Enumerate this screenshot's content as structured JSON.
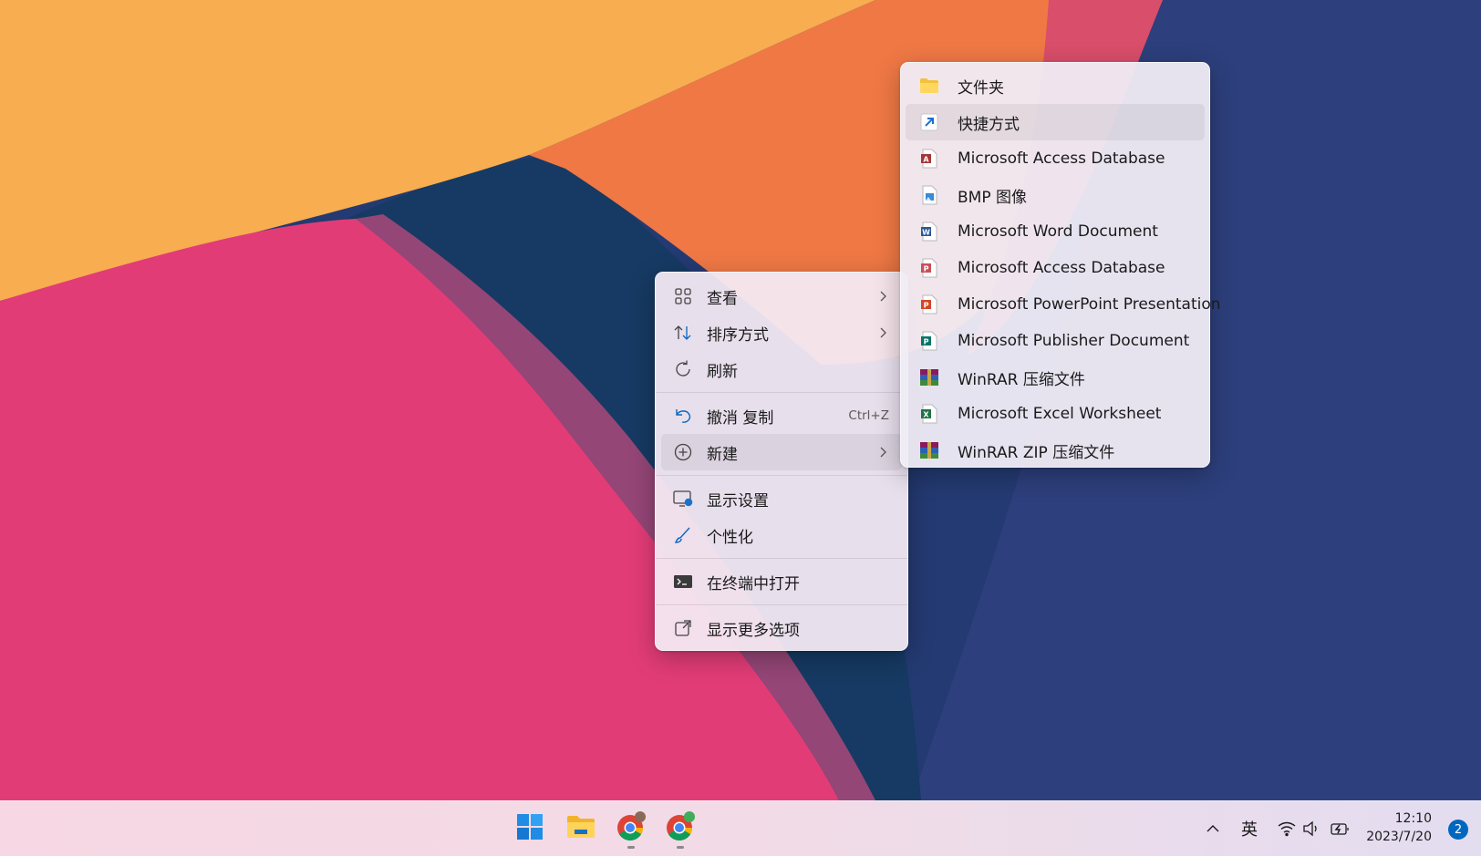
{
  "context_menu": {
    "items": [
      {
        "label": "查看",
        "icon": "grid-icon",
        "has_submenu": true
      },
      {
        "label": "排序方式",
        "icon": "sort-icon",
        "has_submenu": true
      },
      {
        "label": "刷新",
        "icon": "refresh-icon"
      },
      {
        "label": "撤消 复制",
        "icon": "undo-icon",
        "shortcut": "Ctrl+Z"
      },
      {
        "label": "新建",
        "icon": "new-plus-icon",
        "has_submenu": true,
        "highlighted": true
      },
      {
        "label": "显示设置",
        "icon": "display-settings-icon"
      },
      {
        "label": "个性化",
        "icon": "brush-icon"
      },
      {
        "label": "在终端中打开",
        "icon": "terminal-icon"
      },
      {
        "label": "显示更多选项",
        "icon": "more-options-icon"
      }
    ]
  },
  "new_submenu": {
    "items": [
      {
        "label": "文件夹",
        "icon": "folder-icon"
      },
      {
        "label": "快捷方式",
        "icon": "shortcut-icon",
        "highlighted": true
      },
      {
        "label": "Microsoft Access Database",
        "icon": "access-icon"
      },
      {
        "label": "BMP 图像",
        "icon": "bmp-icon"
      },
      {
        "label": "Microsoft Word Document",
        "icon": "word-icon"
      },
      {
        "label": "Microsoft Access Database",
        "icon": "access-icon"
      },
      {
        "label": "Microsoft PowerPoint Presentation",
        "icon": "powerpoint-icon"
      },
      {
        "label": "Microsoft Publisher Document",
        "icon": "publisher-icon"
      },
      {
        "label": "WinRAR 压缩文件",
        "icon": "winrar-icon"
      },
      {
        "label": "Microsoft Excel Worksheet",
        "icon": "excel-icon"
      },
      {
        "label": "WinRAR ZIP 压缩文件",
        "icon": "winrar-zip-icon"
      }
    ]
  },
  "taskbar": {
    "apps": [
      "windows-start-icon",
      "file-explorer-icon",
      "chrome-icon",
      "chrome-icon"
    ],
    "tray": {
      "ime_label": "英",
      "time": "12:10",
      "date": "2023/7/20",
      "notification_count": "2"
    }
  },
  "colors": {
    "wallpaper_orange": "#f7ad50",
    "wallpaper_coral": "#ef7743",
    "wallpaper_pink": "#e23c77",
    "wallpaper_navy": "#173a62",
    "accent": "#0067c0"
  }
}
